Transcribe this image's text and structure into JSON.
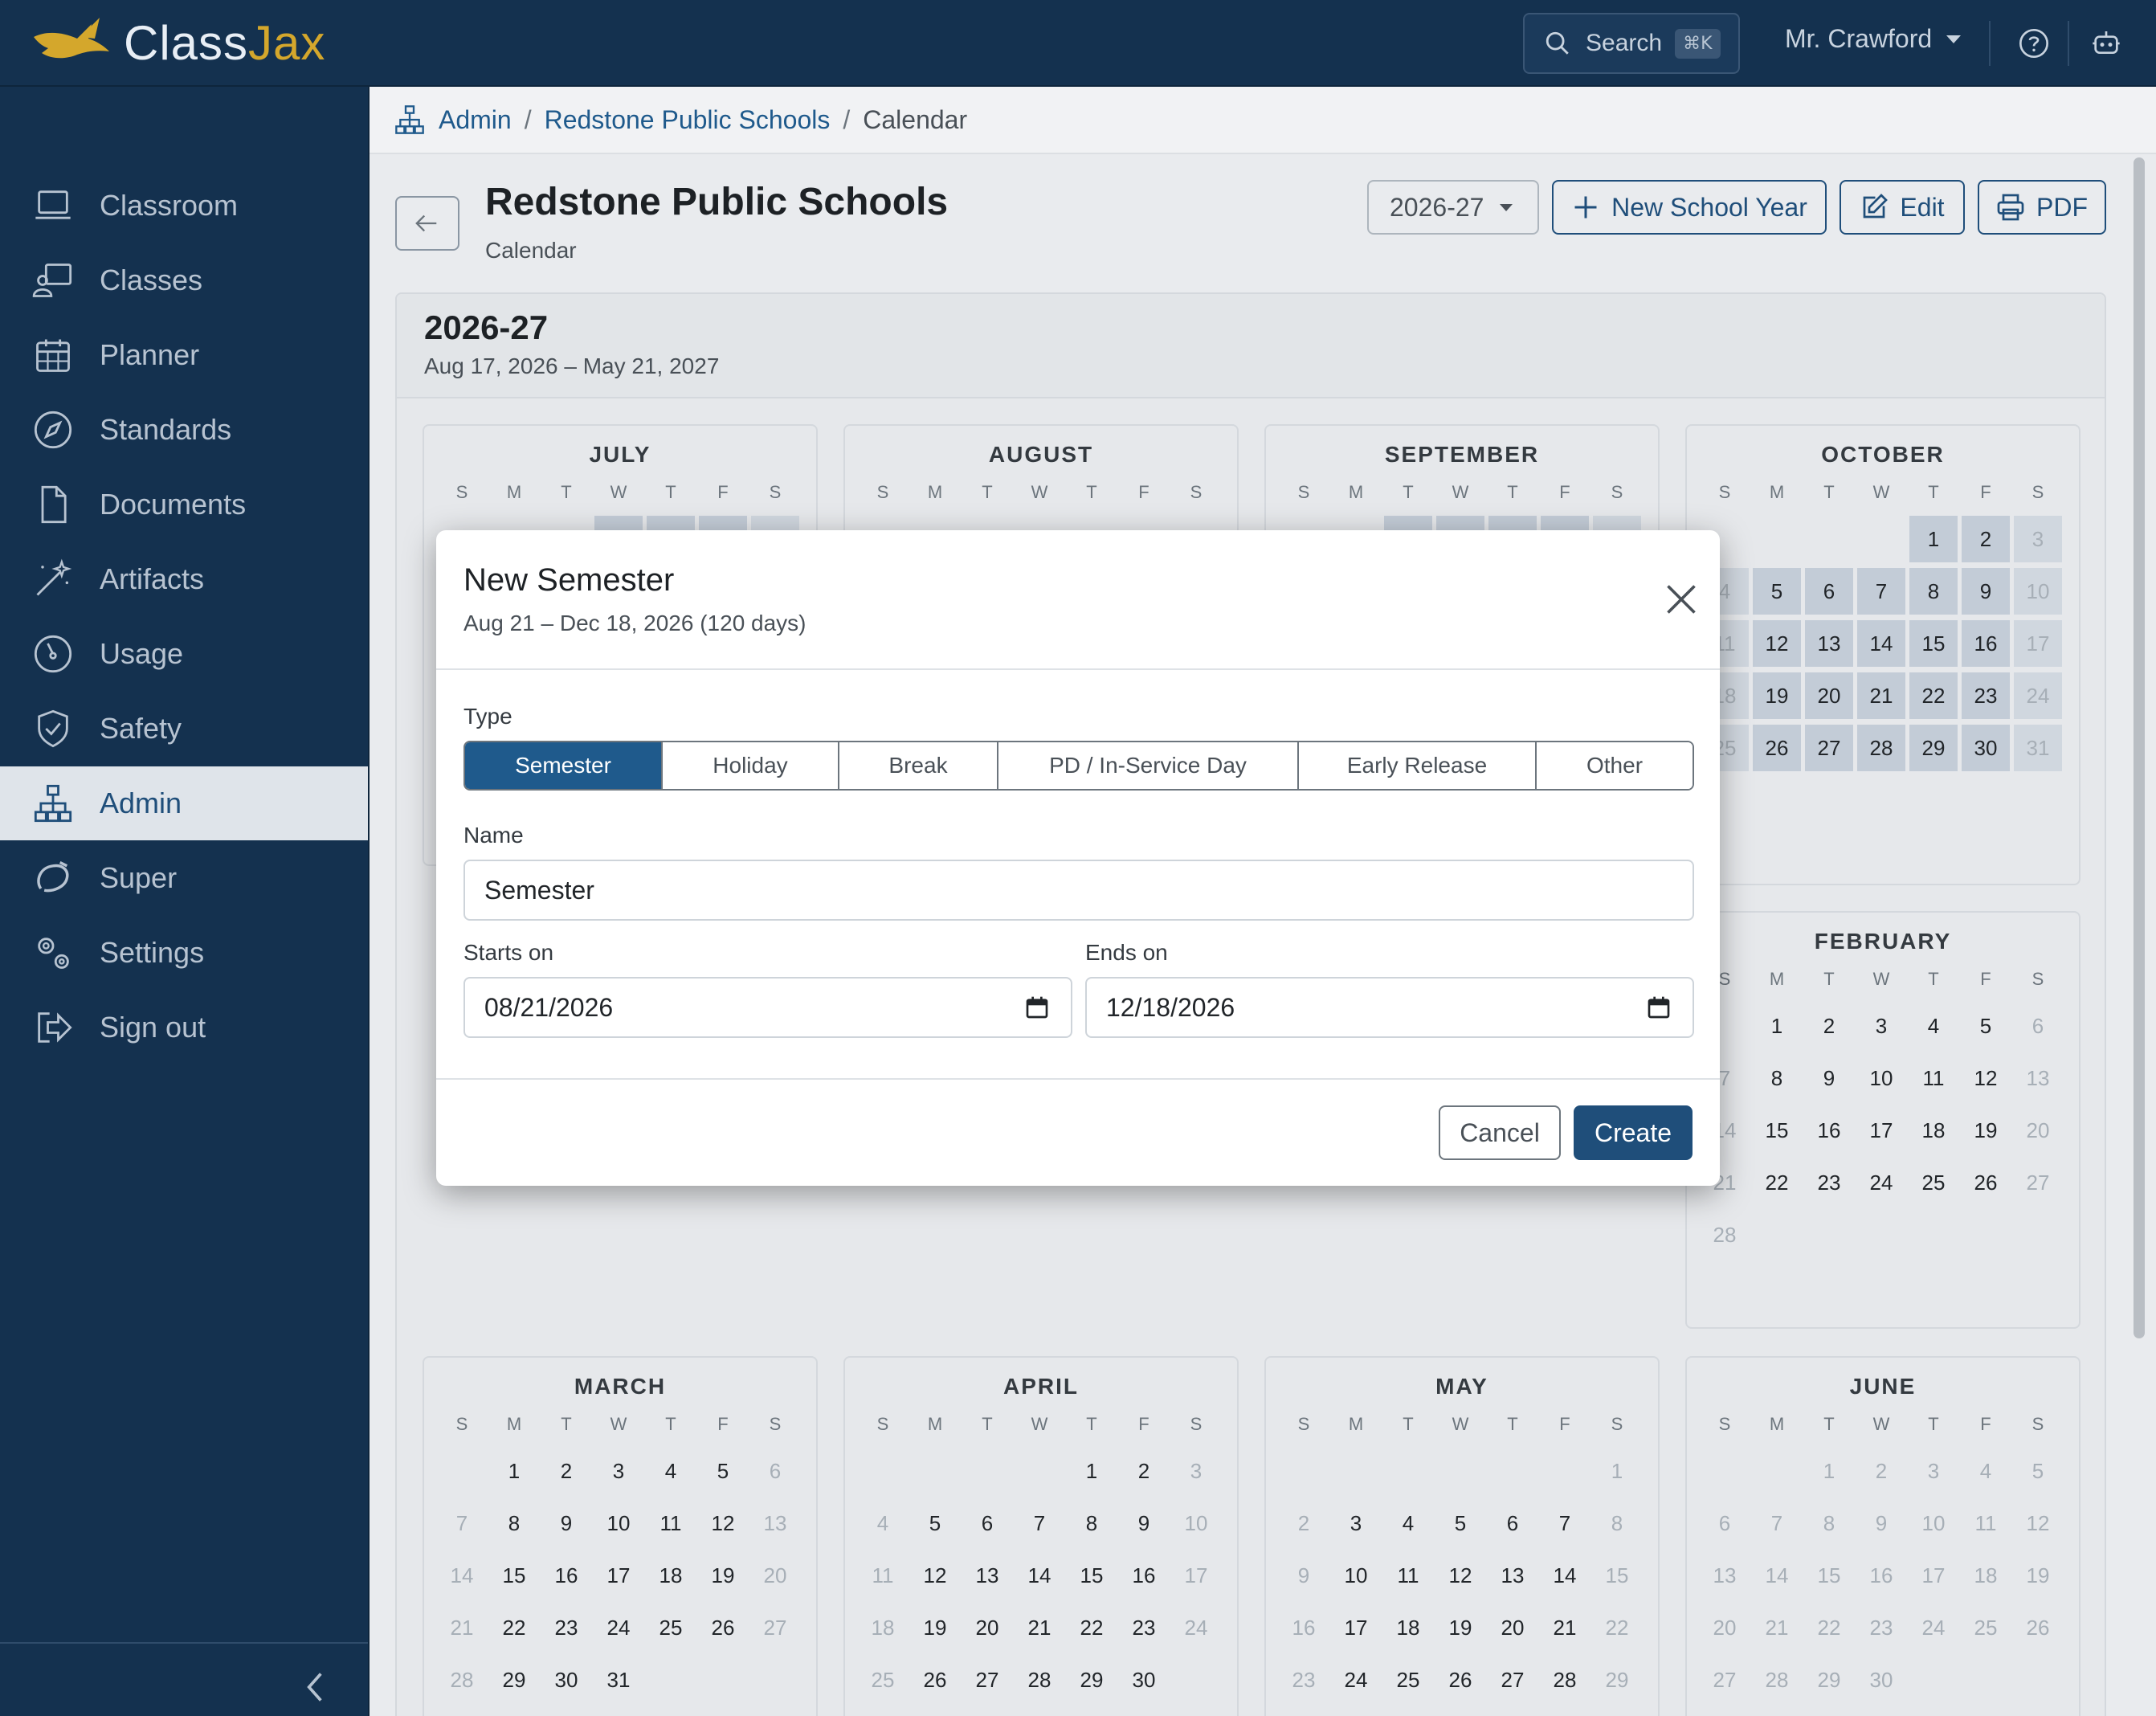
{
  "app": {
    "name_part1": "Class",
    "name_part2": "Jax"
  },
  "topbar": {
    "search_label": "Search",
    "search_kbd": "⌘K",
    "user_name": "Mr. Crawford"
  },
  "sidebar": {
    "items": [
      {
        "label": "Classroom",
        "icon": "laptop-icon"
      },
      {
        "label": "Classes",
        "icon": "teacher-board-icon"
      },
      {
        "label": "Planner",
        "icon": "calendar-icon"
      },
      {
        "label": "Standards",
        "icon": "compass-icon"
      },
      {
        "label": "Documents",
        "icon": "document-icon"
      },
      {
        "label": "Artifacts",
        "icon": "magic-wand-icon"
      },
      {
        "label": "Usage",
        "icon": "gauge-icon"
      },
      {
        "label": "Safety",
        "icon": "shield-check-icon"
      },
      {
        "label": "Admin",
        "icon": "org-chart-icon",
        "active": true
      },
      {
        "label": "Super",
        "icon": "super-icon"
      },
      {
        "label": "Settings",
        "icon": "gears-icon"
      },
      {
        "label": "Sign out",
        "icon": "sign-out-icon"
      }
    ]
  },
  "breadcrumb": {
    "items": [
      "Admin",
      "Redstone Public Schools"
    ],
    "current": "Calendar"
  },
  "header": {
    "title": "Redstone Public Schools",
    "subtitle": "Calendar",
    "year": "2026-27",
    "new_year_label": "New School Year",
    "edit_label": "Edit",
    "pdf_label": "PDF"
  },
  "card": {
    "title": "2026-27",
    "range": "Aug 17, 2026 – May 21, 2027"
  },
  "dow": [
    "S",
    "M",
    "T",
    "W",
    "T",
    "F",
    "S"
  ],
  "months": [
    {
      "name": "JULY"
    },
    {
      "name": "AUGUST"
    },
    {
      "name": "SEPTEMBER"
    },
    {
      "name": "OCTOBER"
    },
    {
      "name": "FEBRUARY"
    },
    {
      "name": "MARCH"
    },
    {
      "name": "APRIL"
    },
    {
      "name": "MAY"
    },
    {
      "name": "JUNE"
    }
  ],
  "modal": {
    "title": "New Semester",
    "subtitle": "Aug 21 – Dec 18, 2026 (120 days)",
    "type_label": "Type",
    "types": [
      "Semester",
      "Holiday",
      "Break",
      "PD / In-Service Day",
      "Early Release",
      "Other"
    ],
    "selected_type": "Semester",
    "name_label": "Name",
    "name_value": "Semester",
    "starts_label": "Starts on",
    "starts_value": "08/21/2026",
    "ends_label": "Ends on",
    "ends_value": "12/18/2026",
    "cancel_label": "Cancel",
    "create_label": "Create"
  },
  "colors": {
    "nav_bg": "#14314f",
    "accent": "#1f5a8c",
    "logo_gold": "#d4a72c",
    "school_day": "#c3ccd7"
  }
}
